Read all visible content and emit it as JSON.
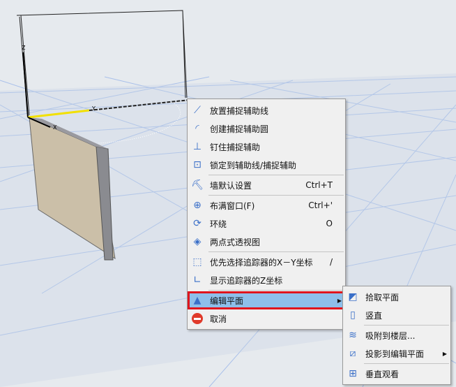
{
  "scene": {
    "axis_labels": {
      "z": "Z",
      "y": "Y",
      "x": "X"
    }
  },
  "context_menu": {
    "items": [
      {
        "label": "放置捕捉辅助线",
        "icon": "place-guide-line-icon"
      },
      {
        "label": "创建捕捉辅助圆",
        "icon": "create-guide-circle-icon"
      },
      {
        "label": "钉住捕捉辅助",
        "icon": "pin-guide-icon"
      },
      {
        "label": "锁定到辅助线/捕捉辅助",
        "icon": "lock-to-guide-icon"
      },
      {
        "label": "墙默认设置",
        "shortcut": "Ctrl+T",
        "icon": "wall-settings-icon"
      },
      {
        "label": "布满窗口(F)",
        "shortcut": "Ctrl+'",
        "icon": "fit-window-icon"
      },
      {
        "label": "环绕",
        "shortcut": "O",
        "icon": "orbit-icon"
      },
      {
        "label": "两点式透视图",
        "icon": "two-point-perspective-icon"
      },
      {
        "label": "优先选择追踪器的X－Y坐标",
        "shortcut": "/",
        "icon": "xy-coordinates-icon"
      },
      {
        "label": "显示追踪器的Z坐标",
        "icon": "z-coordinate-icon"
      },
      {
        "label": "编辑平面",
        "icon": "edit-plane-icon"
      },
      {
        "label": "取消",
        "icon": "cancel-icon"
      }
    ]
  },
  "submenu": {
    "items": [
      {
        "label": "拾取平面",
        "icon": "pick-plane-icon"
      },
      {
        "label": "竖直",
        "icon": "vertical-icon"
      },
      {
        "label": "吸附到楼层...",
        "icon": "snap-to-story-icon"
      },
      {
        "label": "投影到编辑平面",
        "icon": "project-to-plane-icon"
      },
      {
        "label": "垂直观看",
        "icon": "view-perpendicular-icon"
      }
    ]
  },
  "colors": {
    "highlight": "#8ebfea",
    "highlight_border": "#e0141c",
    "cancel": "#e03a2a"
  }
}
